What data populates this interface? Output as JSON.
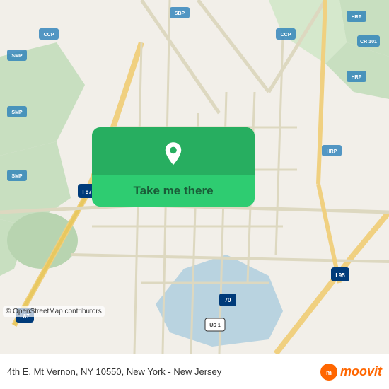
{
  "map": {
    "attribution": "© OpenStreetMap contributors",
    "bg_color": "#e8e0d8"
  },
  "button": {
    "label": "Take me there",
    "bg_color": "#2ecc71",
    "icon": "location-pin"
  },
  "bottom_bar": {
    "address": "4th E, Mt Vernon, NY 10550, New York - New Jersey",
    "brand": "moovit"
  },
  "osm": {
    "text": "© OpenStreetMap contributors"
  }
}
